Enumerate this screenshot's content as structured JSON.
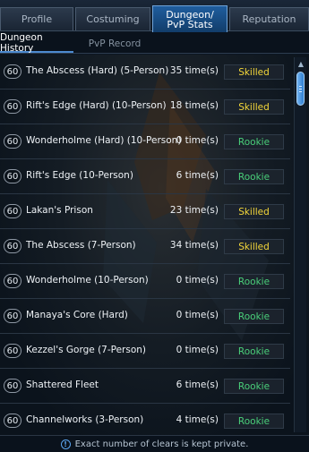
{
  "tabs": [
    {
      "label": "Profile",
      "active": false
    },
    {
      "label": "Costuming",
      "active": false
    },
    {
      "label": "Dungeon/ PvP Stats",
      "active": true
    },
    {
      "label": "Reputation",
      "active": false
    }
  ],
  "subtabs": [
    {
      "label": "Dungeon History",
      "active": true
    },
    {
      "label": "PvP Record",
      "active": false
    }
  ],
  "dungeons": [
    {
      "level": "60",
      "name": "The Abscess (Hard) (5-Person)",
      "times": "35 time(s)",
      "rank": "Skilled"
    },
    {
      "level": "60",
      "name": "Rift's Edge (Hard) (10-Person)",
      "times": "18 time(s)",
      "rank": "Skilled"
    },
    {
      "level": "60",
      "name": "Wonderholme (Hard) (10-Person)",
      "times": "0 time(s)",
      "rank": "Rookie"
    },
    {
      "level": "60",
      "name": "Rift's Edge (10-Person)",
      "times": "6 time(s)",
      "rank": "Rookie"
    },
    {
      "level": "60",
      "name": "Lakan's Prison",
      "times": "23 time(s)",
      "rank": "Skilled"
    },
    {
      "level": "60",
      "name": "The Abscess (7-Person)",
      "times": "34 time(s)",
      "rank": "Skilled"
    },
    {
      "level": "60",
      "name": "Wonderholme (10-Person)",
      "times": "0 time(s)",
      "rank": "Rookie"
    },
    {
      "level": "60",
      "name": "Manaya's Core (Hard)",
      "times": "0 time(s)",
      "rank": "Rookie"
    },
    {
      "level": "60",
      "name": "Kezzel's Gorge (7-Person)",
      "times": "0 time(s)",
      "rank": "Rookie"
    },
    {
      "level": "60",
      "name": "Shattered Fleet",
      "times": "6 time(s)",
      "rank": "Rookie"
    },
    {
      "level": "60",
      "name": "Channelworks (3-Person)",
      "times": "4 time(s)",
      "rank": "Rookie"
    }
  ],
  "footer": {
    "text": "Exact number of clears is kept private.",
    "icon": "info-icon"
  },
  "colors": {
    "skilled": "#f3d63a",
    "rookie": "#4ad07a",
    "active_tab": "#1f5d9e"
  }
}
